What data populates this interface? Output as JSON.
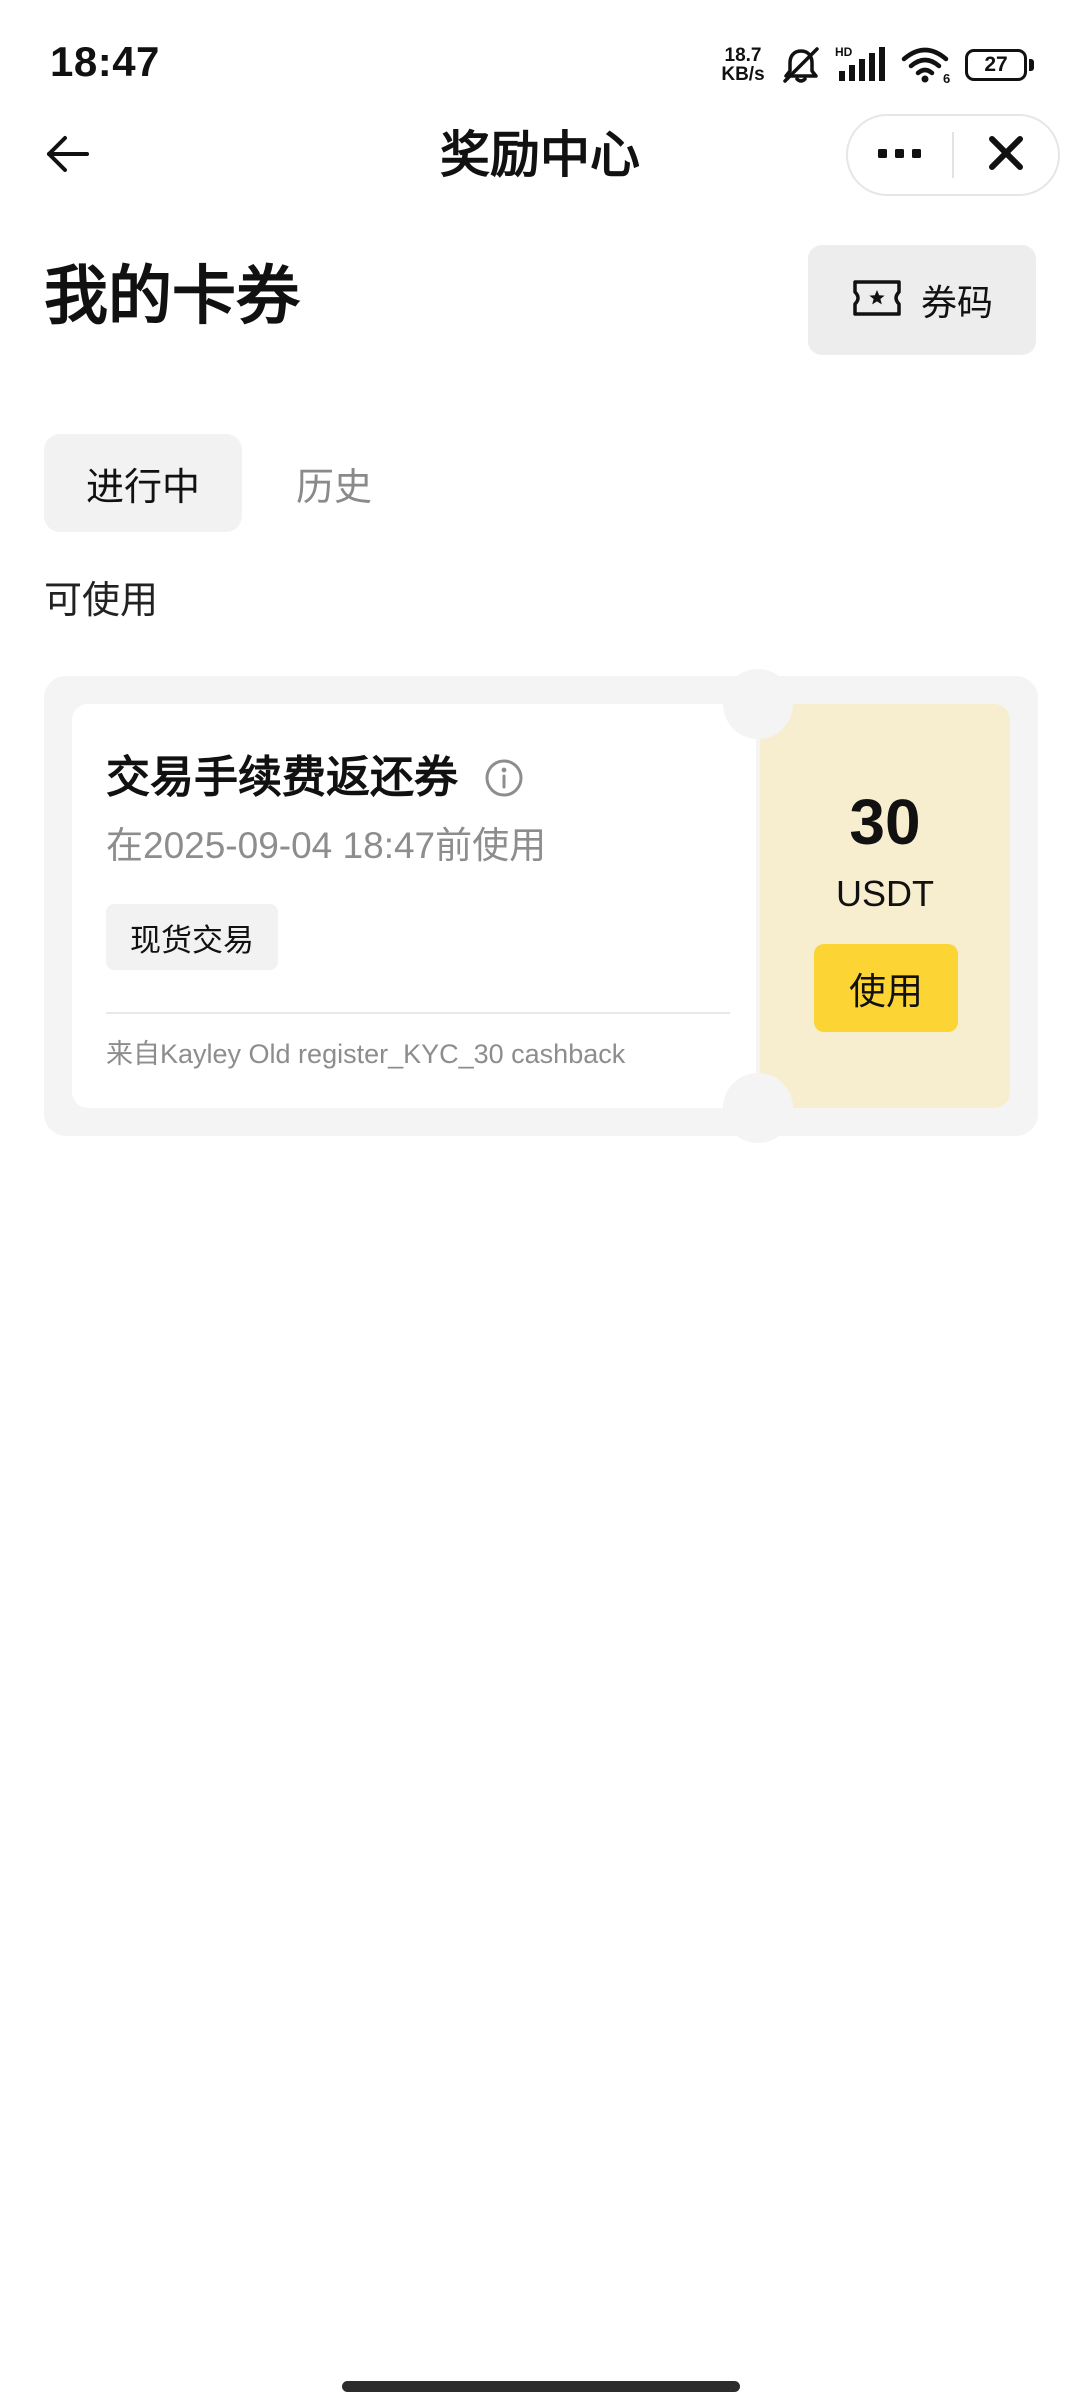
{
  "status_bar": {
    "time": "18:47",
    "net_speed_value": "18.7",
    "net_speed_unit": "KB/s",
    "signal_label": "HD",
    "wifi_label": "6",
    "battery_level": "27",
    "icons": [
      "mute-icon",
      "signal-icon",
      "wifi-icon",
      "battery-icon"
    ]
  },
  "nav": {
    "title": "奖励中心",
    "back_icon": "arrow-left-icon",
    "more_icon": "more-dots-icon",
    "close_icon": "close-icon"
  },
  "header": {
    "page_title": "我的卡券",
    "voucher_code_label": "券码",
    "voucher_code_icon": "ticket-star-icon"
  },
  "tabs": [
    {
      "label": "进行中",
      "active": true
    },
    {
      "label": "历史",
      "active": false
    }
  ],
  "section_label": "可使用",
  "coupons": [
    {
      "title": "交易手续费返还券",
      "expiry": "在2025-09-04 18:47前使用",
      "tag": "现货交易",
      "source": "来自Kayley Old register_KYC_30 cashback",
      "amount": "30",
      "unit": "USDT",
      "action_label": "使用"
    }
  ],
  "colors": {
    "accent": "#fcd535",
    "coupon_right_bg": "#f7edcf",
    "coupon_wrap_bg": "#f4f4f4",
    "muted_text": "#8d8d8d"
  }
}
